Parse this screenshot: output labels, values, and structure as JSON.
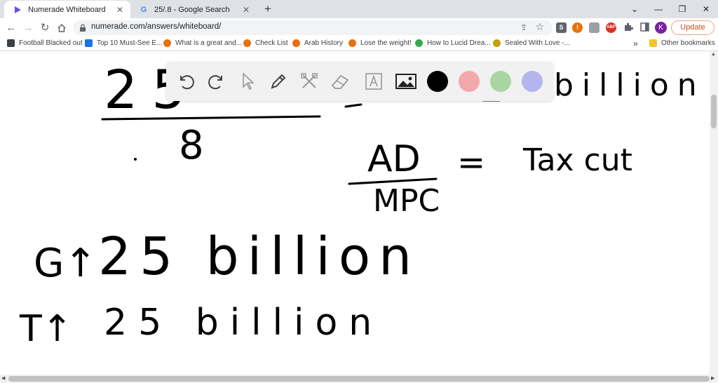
{
  "tabs": [
    {
      "title": "Numerade Whiteboard",
      "active": true,
      "favicon": "numerade-logo-icon"
    },
    {
      "title": "25/.8 - Google Search",
      "active": false,
      "favicon": "google-logo-icon"
    }
  ],
  "window_controls": {
    "minimize": "—",
    "restore": "❐",
    "close": "✕",
    "tab_search": "⌄"
  },
  "address_bar": {
    "url": "numerade.com/answers/whiteboard/"
  },
  "extensions": [
    "S",
    "!",
    "ABP"
  ],
  "profile_initial": "K",
  "update_label": "Update",
  "bookmarks": [
    {
      "label": "Football Blacked out",
      "color": "#3c4043"
    },
    {
      "label": "Top 10 Must-See E...",
      "color": "#1a73e8"
    },
    {
      "label": "What is a great and...",
      "color": "#e8710a"
    },
    {
      "label": "Check List",
      "color": "#e8710a"
    },
    {
      "label": "Arab History",
      "color": "#e8710a"
    },
    {
      "label": "Lose the weight!",
      "color": "#e8710a"
    },
    {
      "label": "How to Lucid Drea...",
      "color": "#34a853"
    },
    {
      "label": "Sealed With Love -...",
      "color": "#c5a000"
    }
  ],
  "bookmarks_overflow": "»",
  "other_bookmarks": "Other bookmarks",
  "whiteboard_tools": [
    "undo-icon",
    "redo-icon",
    "select-pointer-icon",
    "pen-icon",
    "tools-icon",
    "eraser-icon",
    "text-icon",
    "image-icon"
  ],
  "colors": {
    "black": "#000000",
    "pink": "#f2a9a9",
    "green": "#a8d5a2",
    "lavender": "#b4b4ef"
  },
  "handwriting": {
    "fraction_top": "25",
    "fraction_bottom": "8",
    "top_right": "billion",
    "equation_numerator": "AD",
    "equation_denominator": "MPC",
    "equation_equals": "=",
    "equation_result": "Tax cut",
    "line1_label": "G↑",
    "line1_value": "25 billion",
    "line2_label": "T↑",
    "line2_value": "25 billion"
  }
}
